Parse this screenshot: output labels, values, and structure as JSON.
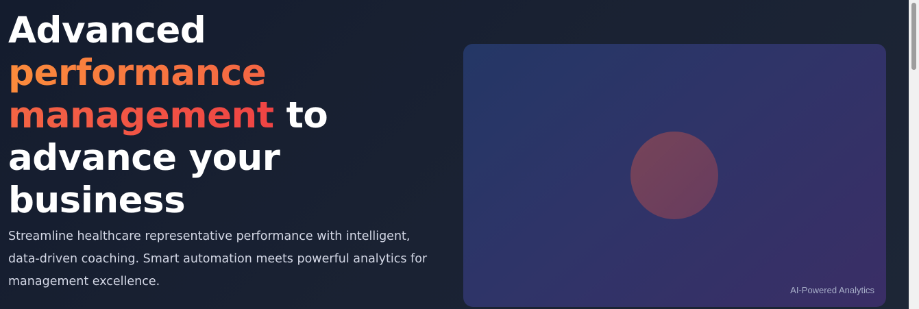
{
  "hero": {
    "headline": {
      "line_start": "Advanced",
      "accent": "performance management",
      "line_end": "to advance your business"
    },
    "subtitle": "Streamline healthcare representative performance with intelligent, data-driven coaching. Smart automation meets powerful analytics for management excellence."
  },
  "visual": {
    "caption": "AI-Powered Analytics"
  },
  "colors": {
    "background": "#141c2e",
    "accent_start": "#fb8b3c",
    "accent_end": "#ef4444",
    "card": "#2f3468",
    "orb": "#7a4558"
  }
}
